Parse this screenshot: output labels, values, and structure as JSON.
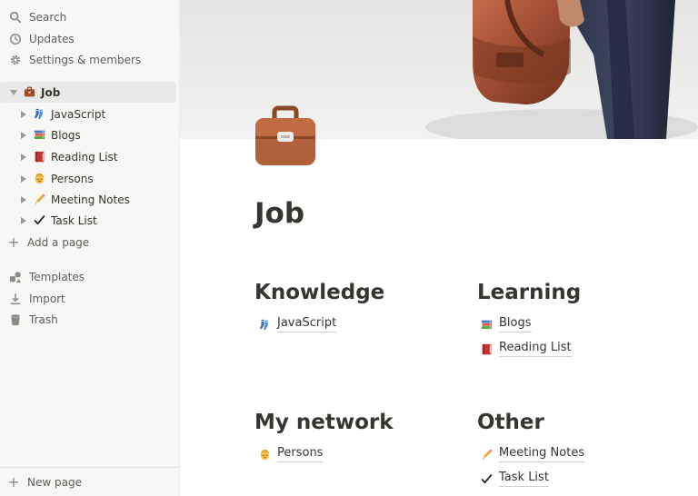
{
  "sidebar": {
    "top_items": [
      {
        "label": "Search",
        "icon": "search-icon"
      },
      {
        "label": "Updates",
        "icon": "clock-icon"
      },
      {
        "label": "Settings & members",
        "icon": "gear-icon"
      }
    ],
    "workspace_page": {
      "label": "Job",
      "icon": "briefcase-icon"
    },
    "child_pages": [
      {
        "label": "JavaScript",
        "icon": "socks-icon"
      },
      {
        "label": "Blogs",
        "icon": "books-icon"
      },
      {
        "label": "Reading List",
        "icon": "red-book-icon"
      },
      {
        "label": "Persons",
        "icon": "person-icon"
      },
      {
        "label": "Meeting Notes",
        "icon": "pencil-icon"
      },
      {
        "label": "Task List",
        "icon": "check-mark-icon"
      }
    ],
    "add_page_label": "Add a page",
    "bottom_items": [
      {
        "label": "Templates",
        "icon": "shapes-icon"
      },
      {
        "label": "Import",
        "icon": "download-icon"
      },
      {
        "label": "Trash",
        "icon": "trash-icon"
      }
    ],
    "new_page_label": "New page"
  },
  "page": {
    "title": "Job",
    "icon": "briefcase-icon",
    "sections": [
      {
        "heading": "Knowledge",
        "links": [
          {
            "label": "JavaScript",
            "icon": "socks-icon"
          }
        ]
      },
      {
        "heading": "Learning",
        "links": [
          {
            "label": "Blogs",
            "icon": "books-icon"
          },
          {
            "label": "Reading List",
            "icon": "red-book-icon"
          }
        ]
      },
      {
        "heading": "My network",
        "links": [
          {
            "label": "Persons",
            "icon": "person-icon"
          }
        ]
      },
      {
        "heading": "Other",
        "links": [
          {
            "label": "Meeting Notes",
            "icon": "pencil-icon"
          },
          {
            "label": "Task List",
            "icon": "check-mark-icon"
          }
        ]
      }
    ]
  },
  "colors": {
    "sidebar_bg": "#f7f7f5",
    "text": "#37352f",
    "muted_text": "#5f5e5b",
    "active_row_bg": "#e9e9e7",
    "briefcase_brown": "#a0522d"
  }
}
